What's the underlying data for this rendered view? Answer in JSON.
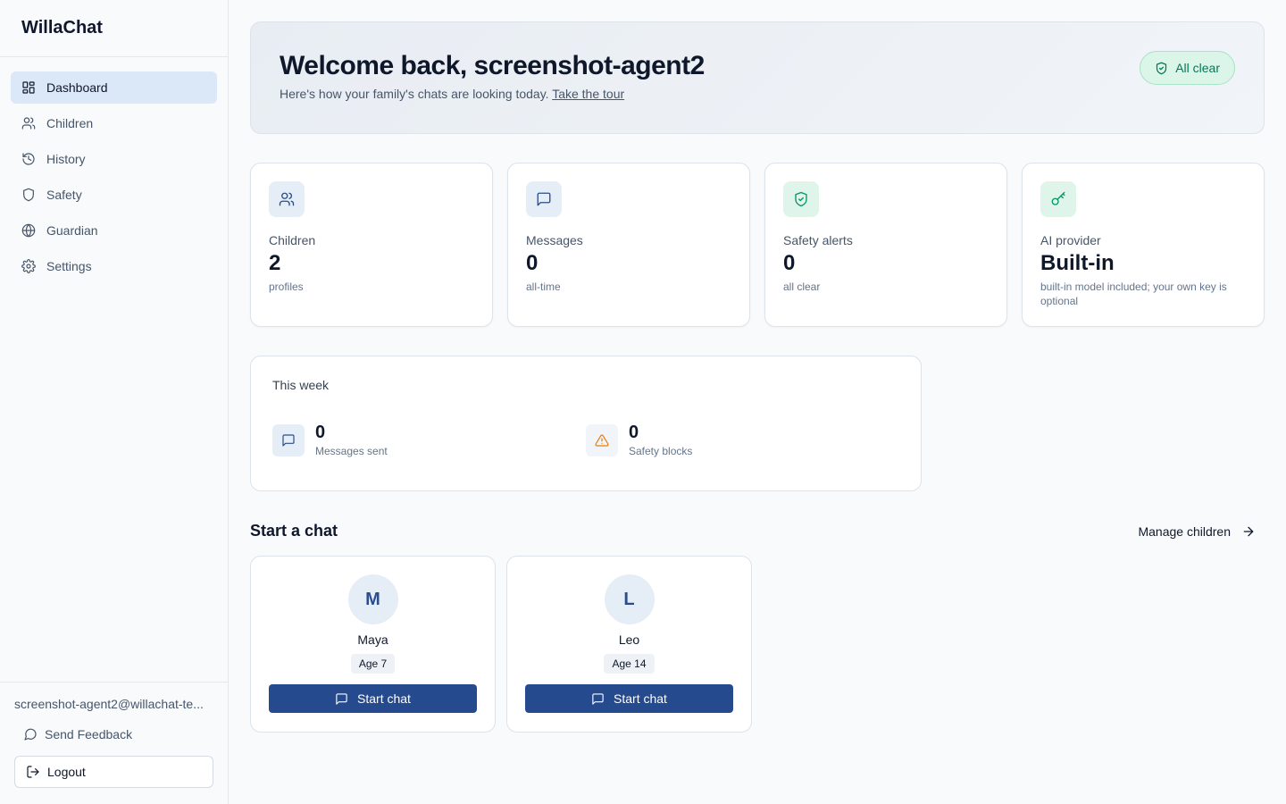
{
  "app": {
    "name": "WillaChat"
  },
  "sidebar": {
    "items": [
      {
        "label": "Dashboard",
        "icon": "dashboard-icon",
        "active": true
      },
      {
        "label": "Children",
        "icon": "users-icon"
      },
      {
        "label": "History",
        "icon": "history-icon"
      },
      {
        "label": "Safety",
        "icon": "shield-icon"
      },
      {
        "label": "Guardian",
        "icon": "globe-icon"
      },
      {
        "label": "Settings",
        "icon": "gear-icon"
      }
    ],
    "user_email": "screenshot-agent2@willachat-te...",
    "feedback_label": "Send Feedback",
    "logout_label": "Logout"
  },
  "hero": {
    "title": "Welcome back, screenshot-agent2",
    "subtitle": "Here's how your family's chats are looking today.",
    "tour_link": "Take the tour",
    "status_badge": "All clear"
  },
  "stats": [
    {
      "label": "Children",
      "value": "2",
      "sub": "profiles",
      "icon": "users-icon",
      "color": "#2b4d8c"
    },
    {
      "label": "Messages",
      "value": "0",
      "sub": "all-time",
      "icon": "message-icon",
      "color": "#2b4d8c"
    },
    {
      "label": "Safety alerts",
      "value": "0",
      "sub": "all clear",
      "icon": "shield-check-icon",
      "color": "#059669"
    },
    {
      "label": "AI provider",
      "value": "Built-in",
      "sub": "built-in model included; your own key is optional",
      "icon": "key-icon",
      "color": "#059669"
    }
  ],
  "week": {
    "title": "This week",
    "items": [
      {
        "value": "0",
        "label": "Messages sent",
        "icon": "message-icon"
      },
      {
        "value": "0",
        "label": "Safety blocks",
        "icon": "warning-icon"
      }
    ]
  },
  "chat_section": {
    "title": "Start a chat",
    "manage_label": "Manage children",
    "children": [
      {
        "initial": "M",
        "name": "Maya",
        "age": "Age 7",
        "button": "Start chat"
      },
      {
        "initial": "L",
        "name": "Leo",
        "age": "Age 14",
        "button": "Start chat"
      }
    ]
  },
  "colors": {
    "accent": "#264a8e",
    "success": "#047857",
    "warning": "#ea7a0c"
  }
}
